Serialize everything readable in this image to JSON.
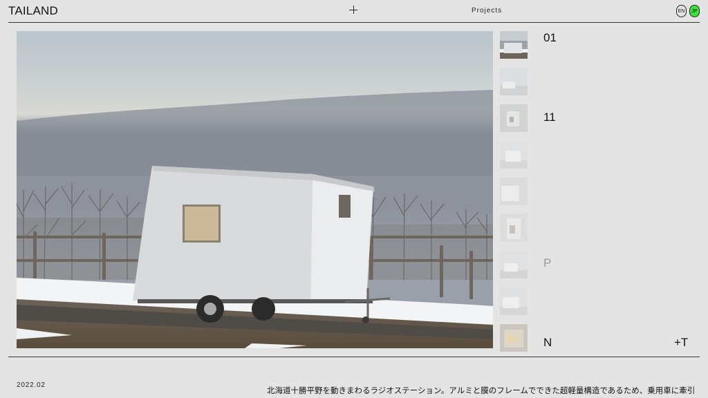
{
  "header": {
    "brand": "TAILAND",
    "nav_projects": "Projects",
    "lang_en": "EN",
    "lang_jp": "JP"
  },
  "gallery": {
    "labels": [
      "01",
      "11",
      "P",
      "N",
      "+T"
    ],
    "thumbnail_count": 9
  },
  "footer": {
    "date": "2022.02",
    "description": "北海道十勝平野を動きまわるラジオステーション。アルミと膜のフレームでできた超軽量構造であるため、乗用車に牽引"
  },
  "colors": {
    "background": "#e4e4e4",
    "accent_jp": "#3ee03e"
  }
}
